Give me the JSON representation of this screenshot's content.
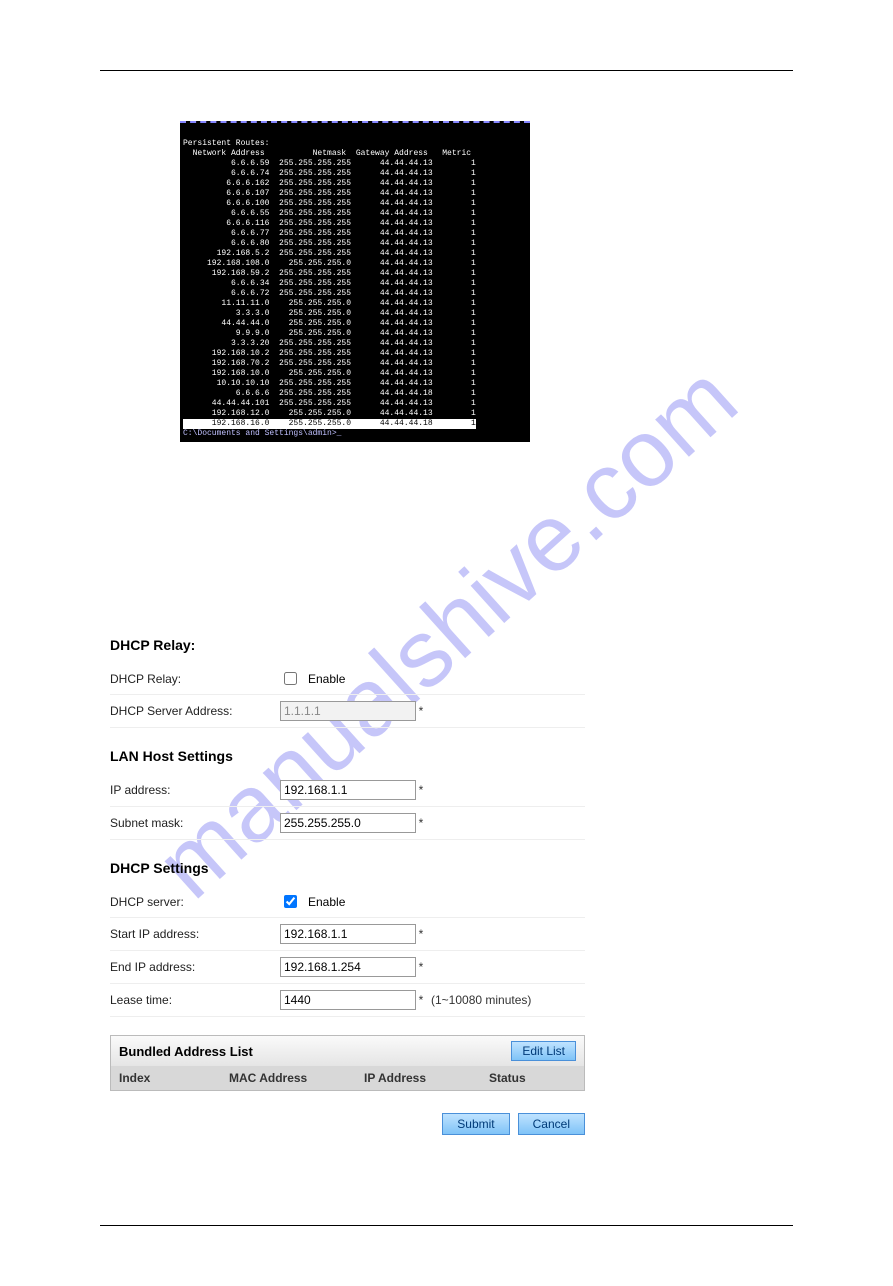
{
  "watermark": "manualshive.com",
  "terminal": {
    "header1": "Persistent Routes:",
    "header2": "  Network Address          Netmask  Gateway Address   Metric",
    "rows": [
      "          6.6.6.59  255.255.255.255      44.44.44.13        1",
      "          6.6.6.74  255.255.255.255      44.44.44.13        1",
      "         6.6.6.162  255.255.255.255      44.44.44.13        1",
      "         6.6.6.107  255.255.255.255      44.44.44.13        1",
      "         6.6.6.100  255.255.255.255      44.44.44.13        1",
      "          6.6.6.55  255.255.255.255      44.44.44.13        1",
      "         6.6.6.116  255.255.255.255      44.44.44.13        1",
      "          6.6.6.77  255.255.255.255      44.44.44.13        1",
      "          6.6.6.80  255.255.255.255      44.44.44.13        1",
      "       192.168.5.2  255.255.255.255      44.44.44.13        1",
      "     192.168.108.0    255.255.255.0      44.44.44.13        1",
      "      192.168.59.2  255.255.255.255      44.44.44.13        1",
      "          6.6.6.34  255.255.255.255      44.44.44.13        1",
      "          6.6.6.72  255.255.255.255      44.44.44.13        1",
      "        11.11.11.0    255.255.255.0      44.44.44.13        1",
      "           3.3.3.0    255.255.255.0      44.44.44.13        1",
      "        44.44.44.0    255.255.255.0      44.44.44.13        1",
      "           9.9.9.0    255.255.255.0      44.44.44.13        1",
      "          3.3.3.20  255.255.255.255      44.44.44.13        1",
      "      192.168.10.2  255.255.255.255      44.44.44.13        1",
      "      192.168.70.2  255.255.255.255      44.44.44.13        1",
      "      192.168.10.0    255.255.255.0      44.44.44.13        1",
      "       10.10.10.10  255.255.255.255      44.44.44.13        1",
      "           6.6.6.6  255.255.255.255      44.44.44.18        1",
      "      44.44.44.101  255.255.255.255      44.44.44.13        1",
      "      192.168.12.0    255.255.255.0      44.44.44.13        1"
    ],
    "hl_row": "      192.168.16.0    255.255.255.0      44.44.44.18        1",
    "prompt": "C:\\Documents and Settings\\admin>_"
  },
  "dhcp_relay": {
    "title": "DHCP Relay:",
    "relay_label": "DHCP Relay:",
    "enable_label": "Enable",
    "server_label": "DHCP Server Address:",
    "server_value": "1.1.1.1",
    "asterisk": "*"
  },
  "lan_host": {
    "title": "LAN Host Settings",
    "ip_label": "IP address:",
    "ip_value": "192.168.1.1",
    "mask_label": "Subnet mask:",
    "mask_value": "255.255.255.0",
    "asterisk": "*"
  },
  "dhcp_settings": {
    "title": "DHCP Settings",
    "server_label": "DHCP server:",
    "enable_label": "Enable",
    "start_label": "Start IP address:",
    "start_value": "192.168.1.1",
    "end_label": "End IP address:",
    "end_value": "192.168.1.254",
    "lease_label": "Lease time:",
    "lease_value": "1440",
    "lease_hint": "(1~10080 minutes)",
    "asterisk": "*"
  },
  "bundled": {
    "title": "Bundled Address List",
    "edit": "Edit List",
    "col_index": "Index",
    "col_mac": "MAC Address",
    "col_ip": "IP Address",
    "col_status": "Status"
  },
  "buttons": {
    "submit": "Submit",
    "cancel": "Cancel"
  }
}
